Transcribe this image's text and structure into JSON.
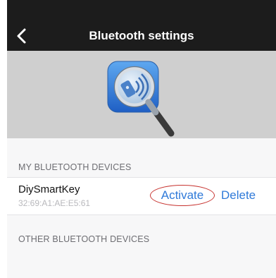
{
  "nav": {
    "title": "Bluetooth settings",
    "back_icon": "chevron-left-icon"
  },
  "banner": {
    "icon": "bluetooth-search-app-icon"
  },
  "my_devices": {
    "header": "MY BLUETOOTH DEVICES",
    "items": [
      {
        "name": "DiySmartKey",
        "address": "32:69:A1:AE:E5:61",
        "activate_label": "Activate",
        "delete_label": "Delete"
      }
    ]
  },
  "other_devices": {
    "header": "OTHER BLUETOOTH DEVICES"
  },
  "colors": {
    "nav_background": "#1c1c1c",
    "banner_background": "#cfcfcf",
    "link": "#2f7ad9",
    "highlight_circle": "#c7332f"
  }
}
